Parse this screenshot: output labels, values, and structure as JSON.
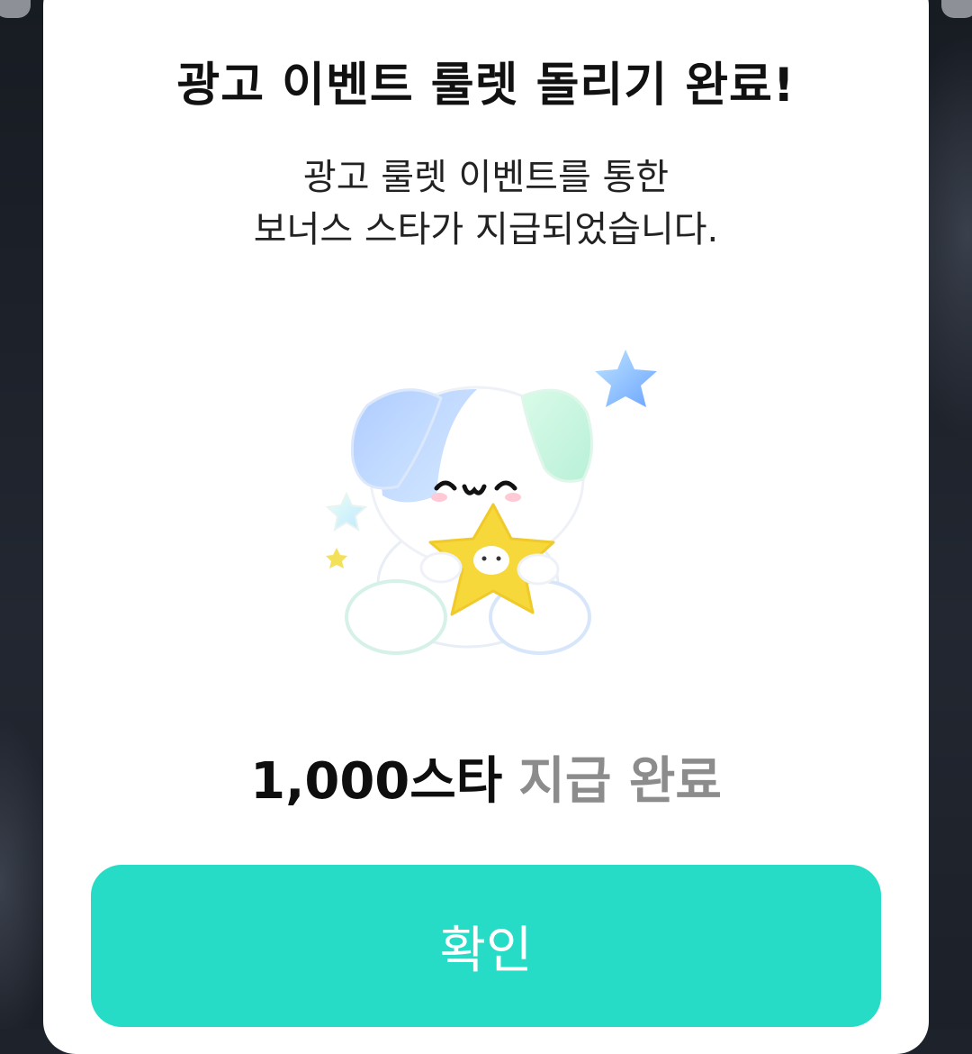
{
  "dialog": {
    "title": "광고 이벤트 룰렛 돌리기 완료!",
    "message_line1": "광고 룰렛 이벤트를 통한",
    "message_line2": "보너스 스타가 지급되었습니다.",
    "reward_amount": "1,000스타",
    "reward_status": "지급 완료",
    "confirm_label": "확인"
  },
  "colors": {
    "accent": "#26dcc7",
    "status_gray": "#8c8c8c",
    "star_yellow": "#f7d83a",
    "ear_blue": "#b6d6ff",
    "ear_mint": "#c7f5de"
  },
  "icons": {
    "mascot": "puppy-holding-star-illustration"
  }
}
